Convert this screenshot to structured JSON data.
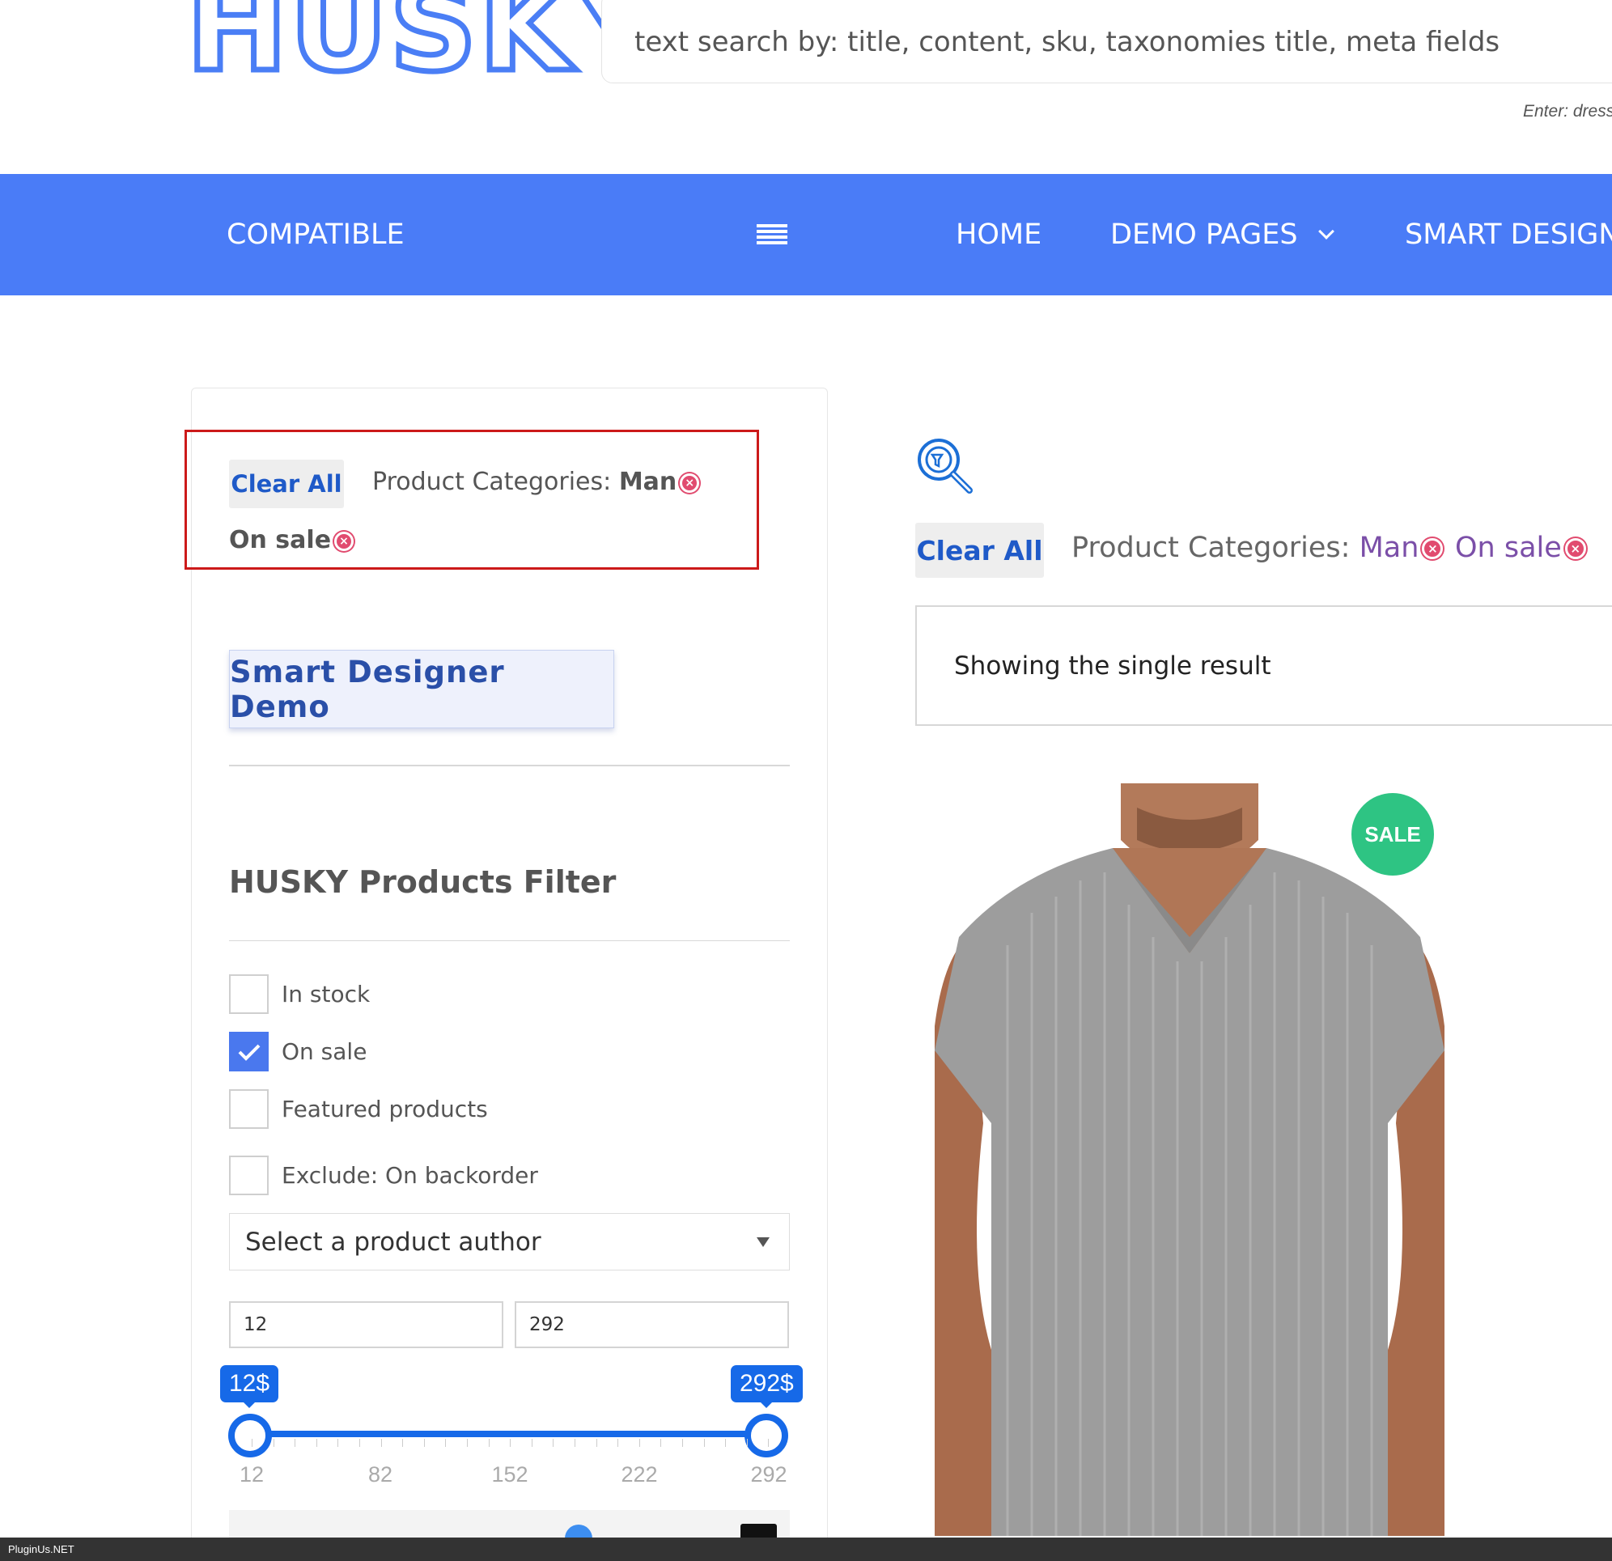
{
  "header": {
    "logo": "HUSKY",
    "search_placeholder": "text search by: title, content, sku, taxonomies title, meta fields",
    "search_hint": "Enter: dress"
  },
  "nav": {
    "brand": "COMPATIBLE",
    "items": [
      {
        "label": "HOME"
      },
      {
        "label": "DEMO PAGES"
      },
      {
        "label": "SMART DESIGNE"
      }
    ]
  },
  "sidebar": {
    "active_filters": {
      "clear_all": "Clear All",
      "category_label": "Product Categories:",
      "category_value": "Man",
      "on_sale": "On sale"
    },
    "demo_button": "Smart Designer Demo",
    "filter_title": "HUSKY Products Filter",
    "checkboxes": [
      {
        "label": "In stock",
        "checked": false
      },
      {
        "label": "On sale",
        "checked": true
      },
      {
        "label": "Featured products",
        "checked": false
      },
      {
        "label": "Exclude: On backorder",
        "checked": false
      }
    ],
    "author_select": "Select a product author",
    "price": {
      "min_value": "12",
      "max_value": "292",
      "min_tip": "12$",
      "max_tip": "292$",
      "ticks": [
        "12",
        "82",
        "152",
        "222",
        "292"
      ]
    }
  },
  "main": {
    "active_filters": {
      "clear_all": "Clear All",
      "category_label": "Product Categories:",
      "category_value": "Man",
      "on_sale": "On sale"
    },
    "results_text": "Showing the single result",
    "sale_badge": "SALE"
  },
  "footer": {
    "text": "PluginUs.NET"
  },
  "colors": {
    "brand_blue": "#4a7cf7",
    "slider_blue": "#1669e8",
    "sale_green": "#2ec483",
    "remove_red": "#e14b6f",
    "highlight_red": "#cc1a1a",
    "link_purple": "#7b4fa8"
  }
}
